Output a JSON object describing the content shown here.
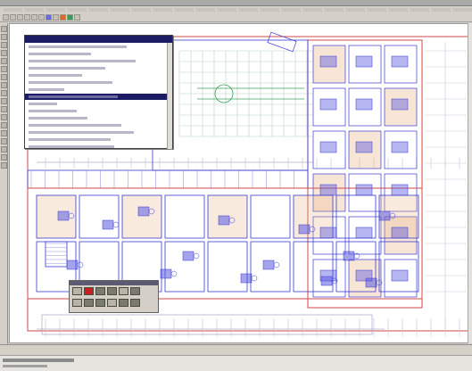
{
  "window": {
    "title": ""
  },
  "menubar": {
    "item_count": 22
  },
  "toolbar": {
    "button_count": 11
  },
  "toolstrip": {
    "tool_count": 18
  },
  "dropdown": {
    "items": [
      "",
      "",
      "",
      "",
      "",
      "",
      "",
      "",
      "",
      "",
      "",
      "",
      "",
      "",
      ""
    ],
    "selected_index": 7
  },
  "floating_toolbar": {
    "title": ""
  },
  "statusbar": {
    "text": ""
  },
  "command_line": {
    "text": ""
  },
  "colors": {
    "wall_blue": "#3a3ad0",
    "furniture_blue": "#5a5ae0",
    "red_dim": "#d04a4a",
    "orange_fill": "#e8b48a",
    "green_grid": "#3aa05a",
    "selection_navy": "#1c1c64"
  },
  "icons": {
    "toolbar": [
      "open-icon",
      "save-icon",
      "print-icon",
      "undo-icon",
      "redo-icon",
      "zoom-icon",
      "pan-icon",
      "layer-icon",
      "color-icon",
      "line-icon",
      "snap-icon"
    ],
    "toolstrip": [
      "select-icon",
      "line-icon",
      "polyline-icon",
      "rectangle-icon",
      "circle-icon",
      "arc-icon",
      "text-icon",
      "dimension-icon",
      "hatch-icon",
      "block-icon",
      "move-icon",
      "copy-icon",
      "rotate-icon",
      "mirror-icon",
      "trim-icon",
      "extend-icon",
      "offset-icon",
      "erase-icon"
    ]
  }
}
